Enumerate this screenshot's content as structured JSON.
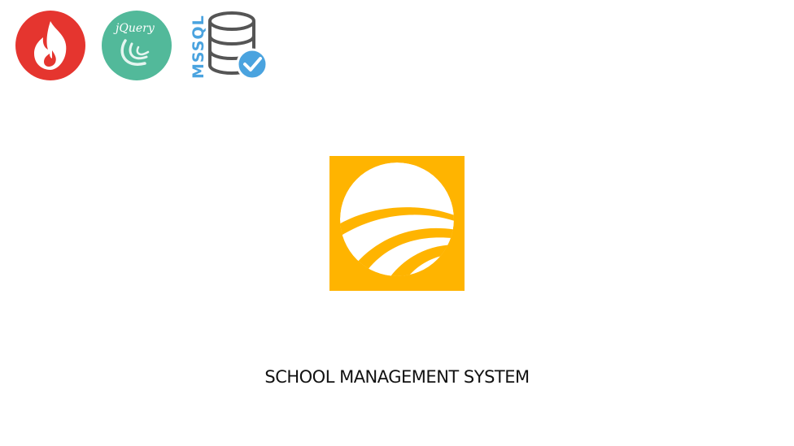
{
  "tech_logos": {
    "codeigniter": {
      "icon": "flame-icon",
      "color": "#e5352f"
    },
    "jquery": {
      "icon": "jquery-icon",
      "label": "jQuery",
      "color": "#52b99a"
    },
    "mssql": {
      "icon": "database-check-icon",
      "label": "MSSQL",
      "color": "#4aa3df",
      "db_color": "#555555"
    }
  },
  "app": {
    "logo_icon": "sunrise-arc-logo",
    "logo_color": "#ffb400",
    "title": "SCHOOL MANAGEMENT SYSTEM"
  }
}
